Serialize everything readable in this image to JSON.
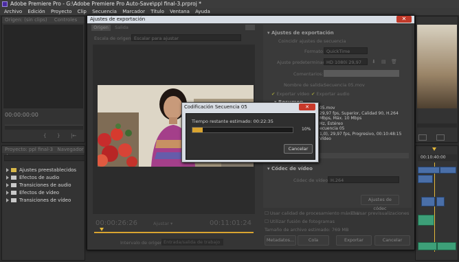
{
  "window_title": "Adobe Premiere Pro - G:\\Adobe Premiere Pro Auto-Save\\ppl final-3.prproj *",
  "menu": [
    "Archivo",
    "Edición",
    "Proyecto",
    "Clip",
    "Secuencia",
    "Marcador",
    "Título",
    "Ventana",
    "Ayuda"
  ],
  "left_panel": {
    "source_tab": "Origen: (sin clips)",
    "source_tab2": "Controles",
    "timecode": "00:00:00:00",
    "effects_tab": "Proyecto: ppl final-3",
    "effects_tab2": "Navegador de",
    "effects_items": [
      "Ajustes preestablecidos",
      "Efectos de audio",
      "Transiciones de audio",
      "Efectos de vídeo",
      "Transiciones de vídeo"
    ]
  },
  "timeline": {
    "timecode": "00:10:40:00"
  },
  "export_dialog": {
    "title": "Ajustes de exportación",
    "close": "✕",
    "tab_source": "Origen",
    "tab_output": "Salida",
    "source_scaling_label": "Escala de origen:",
    "source_scaling_value": "Escalar para ajustar",
    "section_title": "Ajustes de exportación",
    "match_sequence": "Coincidir ajustes de secuencia",
    "format_label": "Formato:",
    "format_value": "QuickTime",
    "preset_label": "Ajuste predeterminado:",
    "preset_value": "HD 1080i 29,97 ...",
    "comments_label": "Comentarios:",
    "output_name_label": "Nombre de salida:",
    "output_name_value": "Secuencia 05.mov",
    "export_video": "Exportar vídeo",
    "export_audio": "Exportar audio",
    "summary_title": "Resumen",
    "summary_lines": [
      "05.mov",
      "29,97 fps, Superior, Calidad 90, H.264",
      "Mbps, Máx. 10 Mbps",
      "Hz, Estéreo",
      "ecuencia 05",
      "1,0), 29,97 fps, Progresivo, 00:10:48:15",
      "Vídeo"
    ],
    "video_codec_title": "Códec de vídeo",
    "video_codec_label": "Códec de vídeo:",
    "video_codec_value": "H.264",
    "codec_settings_button": "Ajustes de códec",
    "max_render_quality": "Usar calidad de procesamiento máxima",
    "use_previews": "Usar previsualizaciones",
    "use_frame_blending": "Utilizar fusión de fotogramas",
    "file_size": "Tamaño de archivo estimado: 769 MB",
    "buttons": {
      "metadata": "Metadatos...",
      "queue": "Cola",
      "export": "Exportar",
      "cancel": "Cancelar"
    },
    "timecode_start": "00:00:26:26",
    "timecode_end": "00:11:01:24",
    "fit_label": "Ajustar",
    "source_range_label": "Intervalo de origen:",
    "source_range_value": "Entrada/salida de trabajo"
  },
  "encoding_dialog": {
    "title": "Codificación Secuencia 05",
    "close": "✕",
    "time_remaining": "Tiempo restante estimado: 00:22:35",
    "percent_text": "10%",
    "progress": 0.1,
    "cancel_label": "Cancelar"
  },
  "colors": {
    "accent_progress": "#d9a430",
    "dialog_bg": "#353535",
    "titlebar_bg": "#3c3c3c"
  }
}
